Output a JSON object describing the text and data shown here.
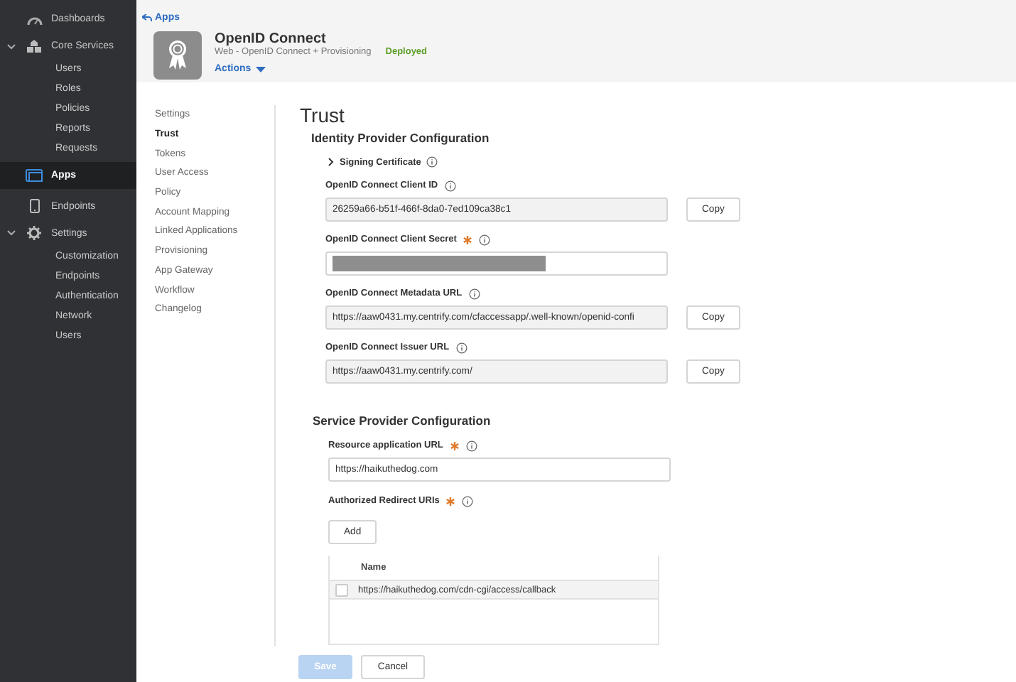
{
  "sidebar": {
    "items": [
      {
        "label": "Dashboards",
        "selected": false
      },
      {
        "label": "Core Services",
        "selected": false,
        "expanded": true,
        "children": [
          {
            "label": "Users"
          },
          {
            "label": "Roles"
          },
          {
            "label": "Policies"
          },
          {
            "label": "Reports"
          },
          {
            "label": "Requests"
          }
        ]
      },
      {
        "label": "Apps",
        "selected": true
      },
      {
        "label": "Endpoints",
        "selected": false
      },
      {
        "label": "Settings",
        "selected": false,
        "expanded": true,
        "children": [
          {
            "label": "Customization"
          },
          {
            "label": "Endpoints"
          },
          {
            "label": "Authentication"
          },
          {
            "label": "Network"
          },
          {
            "label": "Users"
          }
        ]
      }
    ]
  },
  "header": {
    "back_link": "Apps",
    "title": "OpenID Connect",
    "subtitle": "Web - OpenID Connect + Provisioning",
    "status": "Deployed",
    "actions": "Actions"
  },
  "subnav": [
    {
      "label": "Settings",
      "selected": false
    },
    {
      "label": "Trust",
      "selected": true
    },
    {
      "label": "Tokens",
      "selected": false
    },
    {
      "label": "User Access",
      "selected": false
    },
    {
      "label": "Policy",
      "selected": false
    },
    {
      "label": "Account Mapping",
      "selected": false
    },
    {
      "label": "Linked Applications",
      "selected": false
    },
    {
      "label": "Provisioning",
      "selected": false
    },
    {
      "label": "App Gateway",
      "selected": false
    },
    {
      "label": "Workflow",
      "selected": false
    },
    {
      "label": "Changelog",
      "selected": false
    }
  ],
  "page_title": "Trust",
  "identity_provider": {
    "title": "Identity Provider Configuration",
    "signing_certificate": {
      "label": "Signing Certificate",
      "expanded": false
    },
    "fields": [
      {
        "label": "OpenID Connect Client ID",
        "required": false,
        "kind": "text",
        "readonly": true,
        "value": "26259a66-b51f-466f-8da0-7ed109ca38c1",
        "copy": "Copy"
      },
      {
        "label": "OpenID Connect Client Secret",
        "required": true,
        "kind": "secret",
        "readonly": false
      },
      {
        "label": "OpenID Connect Metadata URL",
        "required": false,
        "kind": "text",
        "readonly": true,
        "value": "https://aaw0431.my.centrify.com/cfaccessapp/.well-known/openid-confi",
        "copy": "Copy"
      },
      {
        "label": "OpenID Connect Issuer URL",
        "required": false,
        "kind": "text",
        "readonly": true,
        "value": "https://aaw0431.my.centrify.com/",
        "copy": "Copy"
      }
    ]
  },
  "service_provider": {
    "title": "Service Provider Configuration",
    "resource_url": {
      "label": "Resource application URL",
      "required": true,
      "value": "https://haikuthedog.com"
    },
    "redirect_uris": {
      "label": "Authorized Redirect URIs",
      "required": true,
      "add": "Add",
      "column": "Name",
      "rows": [
        {
          "value": "https://haikuthedog.com/cdn-cgi/access/callback",
          "checked": false
        }
      ]
    }
  },
  "footer": {
    "save": {
      "label": "Save",
      "disabled": true
    },
    "cancel": "Cancel"
  }
}
